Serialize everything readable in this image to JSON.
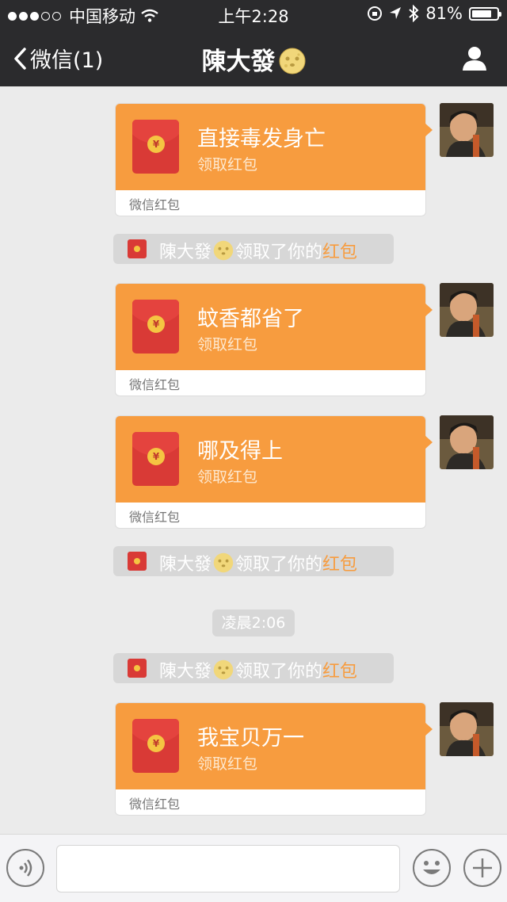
{
  "status_bar": {
    "carrier": "中国移动",
    "time": "上午2:28",
    "battery": "81%",
    "battery_level": 0.81
  },
  "nav": {
    "back_label": "微信(1)",
    "title": "陳大發"
  },
  "red_packet": {
    "subtitle": "领取红包",
    "footer": "微信红包",
    "coin": "¥"
  },
  "messages": [
    {
      "title": "直接毒发身亡"
    },
    {
      "title": "蚊香都省了"
    },
    {
      "title": "哪及得上"
    },
    {
      "title": "我宝贝万一"
    }
  ],
  "system_notice": {
    "name": "陳大發",
    "text": "领取了你的",
    "highlight": "红包"
  },
  "timestamp": "凌晨2:06",
  "colors": {
    "bar": "#2b2b2d",
    "packet_orange": "#f79c3f",
    "envelope_red": "#d93a36",
    "background": "#ebebeb"
  },
  "icons": {
    "back": "chevron-left-icon",
    "contact": "person-icon",
    "voice": "voice-icon",
    "emoji": "smiley-icon",
    "more": "plus-icon"
  }
}
